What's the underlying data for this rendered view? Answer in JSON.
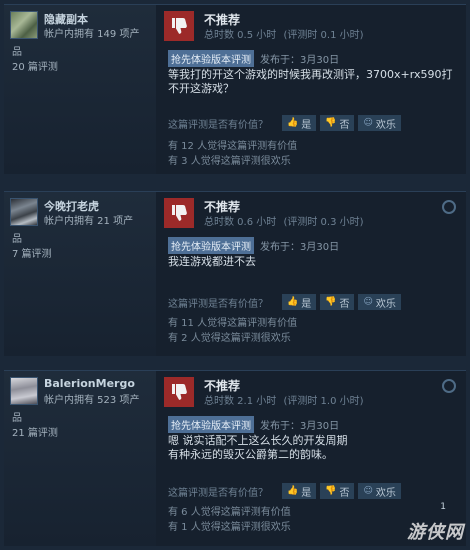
{
  "reviews": [
    {
      "username": "隐藏副本",
      "owned": "帐户内拥有 149 项产",
      "owned_wrap": "品",
      "review_count": "20 篇评测",
      "verdict": "不推荐",
      "total_hours": "总时数 0.5 小时",
      "review_hours": "(评测时 0.1 小时)",
      "ea_badge": "抢先体验版本评测",
      "posted": "发布于：3月30日",
      "content": "等我打的开这个游戏的时候我再改测评，3700x+rx590打不开这游戏？",
      "helpful_q": "这篇评测是否有价值？",
      "yes": "是",
      "no": "否",
      "funny": "欢乐",
      "stat1": "有 12 人觉得这篇评测有价值",
      "stat2": "有 3 人觉得这篇评测很欢乐"
    },
    {
      "username": "今晚打老虎",
      "owned": "帐户内拥有 21 项产",
      "owned_wrap": "品",
      "review_count": "7 篇评测",
      "verdict": "不推荐",
      "total_hours": "总时数 0.6 小时",
      "review_hours": "(评测时 0.3 小时)",
      "ea_badge": "抢先体验版本评测",
      "posted": "发布于：3月30日",
      "content": "我连游戏都进不去",
      "helpful_q": "这篇评测是否有价值？",
      "yes": "是",
      "no": "否",
      "funny": "欢乐",
      "stat1": "有 11 人觉得这篇评测有价值",
      "stat2": "有 2 人觉得这篇评测很欢乐"
    },
    {
      "username": "BalerionMergo",
      "owned": "帐户内拥有 523 项产",
      "owned_wrap": "品",
      "review_count": "21 篇评测",
      "verdict": "不推荐",
      "total_hours": "总时数 2.1 小时",
      "review_hours": "(评测时 1.0 小时)",
      "ea_badge": "抢先体验版本评测",
      "posted": "发布于：3月30日",
      "content": "嗯 说实话配不上这么长久的开发周期\n有种永远的毁灭公爵第二的韵味。",
      "helpful_q": "这篇评测是否有价值？",
      "yes": "是",
      "no": "否",
      "funny": "欢乐",
      "stat1": "有 6 人觉得这篇评测有价值",
      "stat2": "有 1 人觉得这篇评测很欢乐"
    }
  ],
  "page_num": "1",
  "watermark": "游侠网",
  "colors": {
    "thumb_down_bg": "#9c2a29",
    "ea_badge_bg": "#4e6f96",
    "page_bg": "#1b2838"
  }
}
